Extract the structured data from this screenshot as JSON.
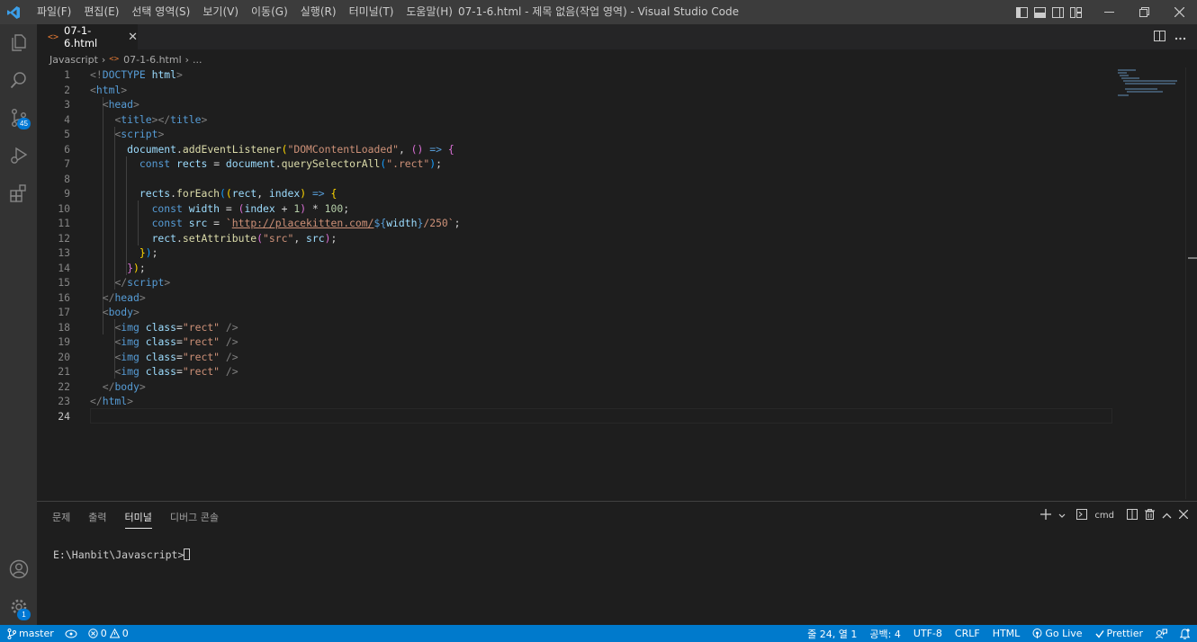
{
  "window": {
    "title": "07-1-6.html - 제목 없음(작업 영역) - Visual Studio Code",
    "menu": [
      "파일(F)",
      "편집(E)",
      "선택 영역(S)",
      "보기(V)",
      "이동(G)",
      "실행(R)",
      "터미널(T)",
      "도움말(H)"
    ]
  },
  "activity": {
    "source_control_badge": "45",
    "settings_badge": "1"
  },
  "tab": {
    "icon": "<>",
    "label": "07-1-6.html",
    "close": "✕"
  },
  "breadcrumb": {
    "folder": "Javascript",
    "file": "07-1-6.html",
    "more": "..."
  },
  "editor": {
    "line_numbers": [
      "1",
      "2",
      "3",
      "4",
      "5",
      "6",
      "7",
      "8",
      "9",
      "10",
      "11",
      "12",
      "13",
      "14",
      "15",
      "16",
      "17",
      "18",
      "19",
      "20",
      "21",
      "22",
      "23",
      "24"
    ],
    "current_line": "24"
  },
  "panel": {
    "tabs": [
      "문제",
      "출력",
      "터미널",
      "디버그 콘솔"
    ],
    "active_tab": "터미널",
    "shell": "cmd",
    "terminal_prompt": "E:\\Hanbit\\Javascript>"
  },
  "status": {
    "branch": "master",
    "errors": "0",
    "warnings": "0",
    "cursor": "줄 24, 열 1",
    "spaces": "공백: 4",
    "encoding": "UTF-8",
    "eol": "CRLF",
    "language": "HTML",
    "go_live": "Go Live",
    "prettier": "Prettier"
  },
  "colors": {
    "accent": "#007acc",
    "titlebar": "#3c3c3c",
    "activitybar": "#333333",
    "editor_bg": "#1e1e1e"
  }
}
